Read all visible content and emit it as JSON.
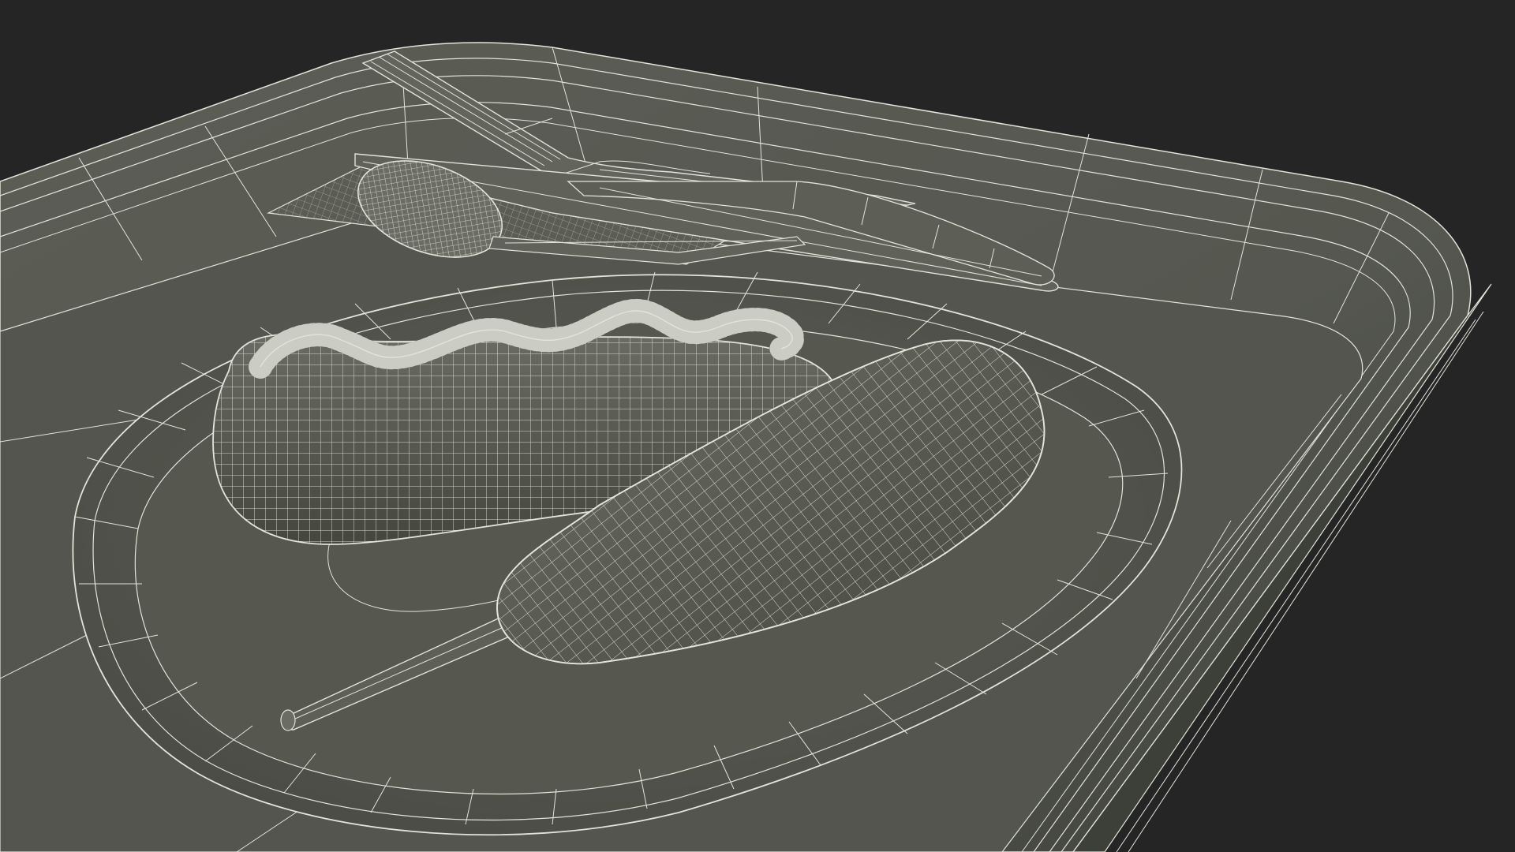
{
  "viewport": {
    "background_color": "#252525",
    "surface_color": "#585a52",
    "wire_color": "#e2e4da"
  },
  "scene": {
    "description_hidden": "",
    "objects": [
      {
        "name": "tray"
      },
      {
        "name": "plate"
      },
      {
        "name": "corn-dog-with-sauce"
      },
      {
        "name": "corn-dog-on-stick"
      },
      {
        "name": "fork"
      },
      {
        "name": "spoon"
      },
      {
        "name": "knife"
      },
      {
        "name": "napkin"
      }
    ]
  }
}
